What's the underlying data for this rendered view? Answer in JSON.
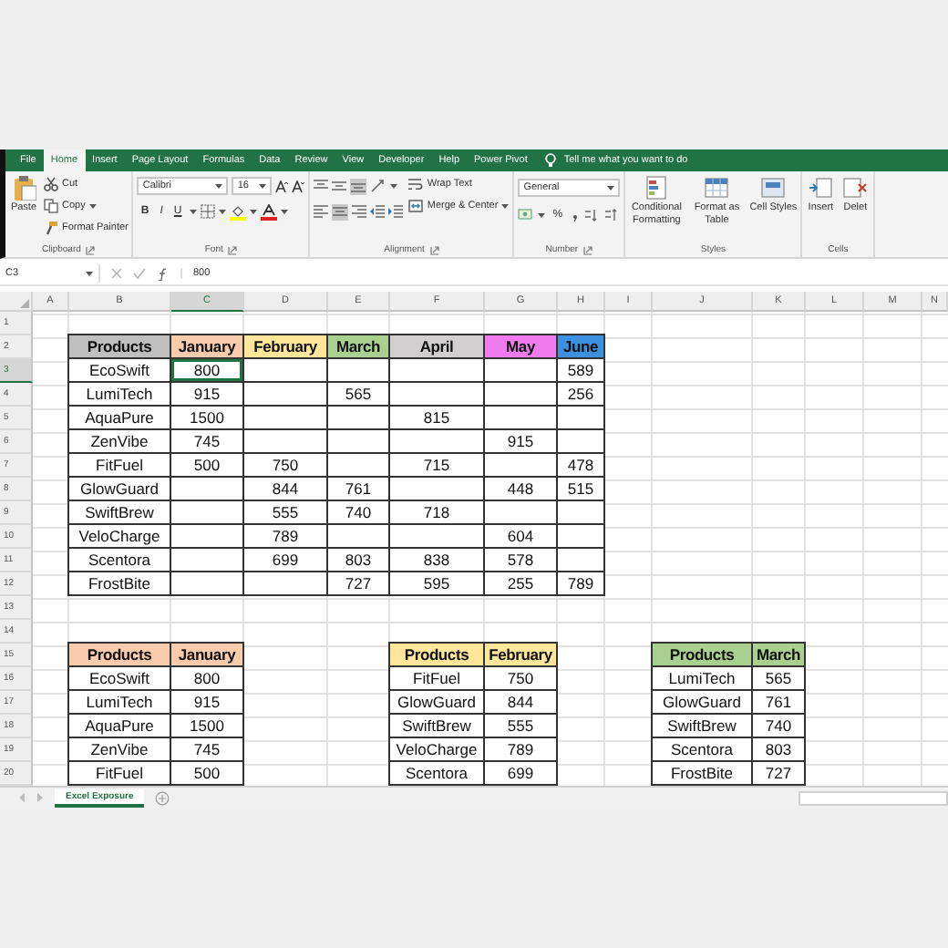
{
  "ribbon_tabs": [
    {
      "label": "File",
      "selected": false
    },
    {
      "label": "Home",
      "selected": true
    },
    {
      "label": "Insert",
      "selected": false
    },
    {
      "label": "Page Layout",
      "selected": false
    },
    {
      "label": "Formulas",
      "selected": false
    },
    {
      "label": "Data",
      "selected": false
    },
    {
      "label": "Review",
      "selected": false
    },
    {
      "label": "View",
      "selected": false
    },
    {
      "label": "Developer",
      "selected": false
    },
    {
      "label": "Help",
      "selected": false
    },
    {
      "label": "Power Pivot",
      "selected": false
    }
  ],
  "tell_me": "Tell me what you want to do",
  "ribbon_groups": [
    {
      "kind": "clipboard",
      "label": "Clipboard",
      "paste": "Paste",
      "cut": "Cut",
      "copy": "Copy",
      "painter": "Format Painter"
    },
    {
      "kind": "font",
      "label": "Font",
      "font": "Calibri",
      "size": "16",
      "bold": "B",
      "italic": "I",
      "underline": "U"
    },
    {
      "kind": "alignment",
      "label": "Alignment",
      "wrap": "Wrap Text",
      "merge": "Merge & Center"
    },
    {
      "kind": "number",
      "label": "Number",
      "format": "General",
      "percent": "%"
    },
    {
      "kind": "styles",
      "label": "Styles",
      "buttons": [
        "Conditional Formatting",
        "Format as Table",
        "Cell Styles"
      ]
    },
    {
      "kind": "cells",
      "label": "Cells",
      "buttons": [
        "Insert",
        "Delet"
      ]
    }
  ],
  "formula": "800",
  "sheet": {
    "selected_cell": "C3",
    "columns": [
      "A",
      "B",
      "C",
      "D",
      "E",
      "F",
      "G",
      "H",
      "I",
      "J",
      "K",
      "L",
      "M",
      "N"
    ],
    "rows": [
      {
        "label": "1"
      },
      {
        "label": "2",
        "cells": [
          null,
          {
            "text": "Products",
            "color": "#bfbfbf"
          },
          {
            "text": "January",
            "color": "#f8cbad"
          },
          {
            "text": "February",
            "color": "#ffe699"
          },
          {
            "text": "March",
            "color": "#a9d08e"
          },
          {
            "text": "April",
            "color": "#d0cece"
          },
          {
            "text": "May",
            "color": "#f07cf0"
          },
          {
            "text": "June",
            "color": "#3d8fe0"
          }
        ]
      },
      {
        "label": "3",
        "cells": [
          null,
          "EcoSwift",
          "800",
          {
            "bordered": true
          },
          {
            "bordered": true
          },
          {
            "bordered": true
          },
          {
            "bordered": true
          },
          "589"
        ]
      },
      {
        "label": "4",
        "cells": [
          null,
          "LumiTech",
          "915",
          {
            "bordered": true
          },
          "565",
          {
            "bordered": true
          },
          {
            "bordered": true
          },
          "256"
        ]
      },
      {
        "label": "5",
        "cells": [
          null,
          "AquaPure",
          "1500",
          {
            "bordered": true
          },
          {
            "bordered": true
          },
          "815",
          {
            "bordered": true
          },
          {
            "bordered": true
          }
        ]
      },
      {
        "label": "6",
        "cells": [
          null,
          "ZenVibe",
          "745",
          {
            "bordered": true
          },
          {
            "bordered": true
          },
          {
            "bordered": true
          },
          "915",
          {
            "bordered": true
          }
        ]
      },
      {
        "label": "7",
        "cells": [
          null,
          "FitFuel",
          "500",
          "750",
          {
            "bordered": true
          },
          "715",
          {
            "bordered": true
          },
          "478"
        ]
      },
      {
        "label": "8",
        "cells": [
          null,
          "GlowGuard",
          {
            "bordered": true
          },
          "844",
          "761",
          {
            "bordered": true
          },
          "448",
          "515"
        ]
      },
      {
        "label": "9",
        "cells": [
          null,
          "SwiftBrew",
          {
            "bordered": true
          },
          "555",
          "740",
          "718",
          {
            "bordered": true
          },
          {
            "bordered": true
          }
        ]
      },
      {
        "label": "10",
        "cells": [
          null,
          "VeloCharge",
          {
            "bordered": true
          },
          "789",
          {
            "bordered": true
          },
          {
            "bordered": true
          },
          "604",
          {
            "bordered": true
          }
        ]
      },
      {
        "label": "11",
        "cells": [
          null,
          "Scentora",
          {
            "bordered": true
          },
          "699",
          "803",
          "838",
          "578",
          {
            "bordered": true
          }
        ]
      },
      {
        "label": "12",
        "cells": [
          null,
          "FrostBite",
          {
            "bordered": true
          },
          {
            "bordered": true
          },
          "727",
          "595",
          "255",
          "789"
        ]
      },
      {
        "label": "13"
      },
      {
        "label": "14"
      },
      {
        "label": "15",
        "cells": [
          null,
          {
            "text": "Products",
            "color": "#f8cbad"
          },
          {
            "text": "January",
            "color": "#f8cbad"
          },
          null,
          null,
          {
            "text": "Products",
            "color": "#ffe699"
          },
          {
            "text": "February",
            "color": "#ffe699"
          },
          null,
          null,
          {
            "text": "Products",
            "color": "#a9d08e"
          },
          {
            "text": "March",
            "color": "#a9d08e"
          }
        ]
      },
      {
        "label": "16",
        "cells": [
          null,
          "EcoSwift",
          "800",
          null,
          null,
          "FitFuel",
          "750",
          null,
          null,
          "LumiTech",
          "565"
        ]
      },
      {
        "label": "17",
        "cells": [
          null,
          "LumiTech",
          "915",
          null,
          null,
          "GlowGuard",
          "844",
          null,
          null,
          "GlowGuard",
          "761"
        ]
      },
      {
        "label": "18",
        "cells": [
          null,
          "AquaPure",
          "1500",
          null,
          null,
          "SwiftBrew",
          "555",
          null,
          null,
          "SwiftBrew",
          "740"
        ]
      },
      {
        "label": "19",
        "cells": [
          null,
          "ZenVibe",
          "745",
          null,
          null,
          "VeloCharge",
          "789",
          null,
          null,
          "Scentora",
          "803"
        ]
      },
      {
        "label": "20",
        "cells": [
          null,
          "FitFuel",
          "500",
          null,
          null,
          "Scentora",
          "699",
          null,
          null,
          "FrostBite",
          "727"
        ]
      }
    ]
  },
  "sheet_tabs": [
    {
      "label": "Excel Exposure",
      "selected": true
    }
  ]
}
